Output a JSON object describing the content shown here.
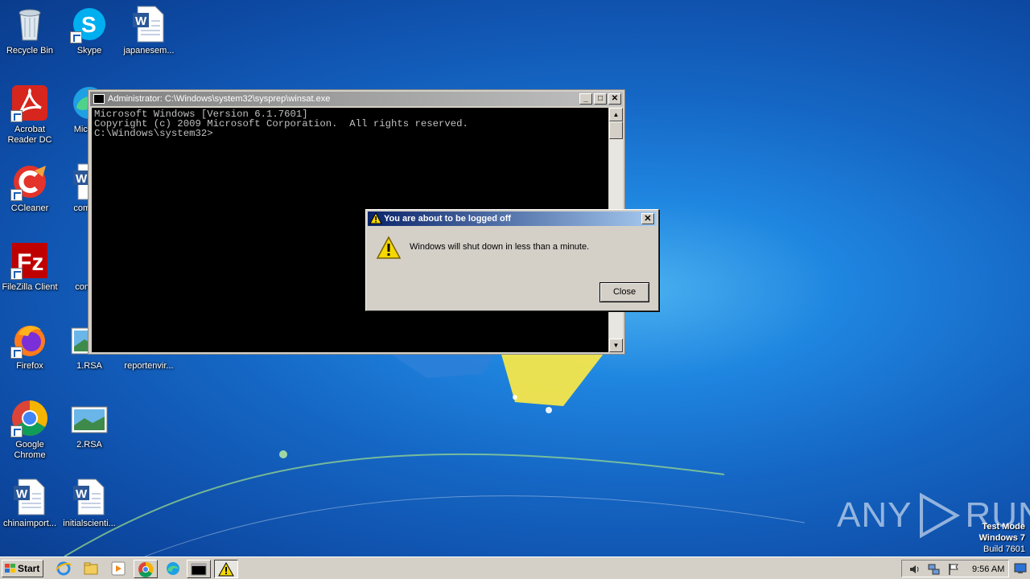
{
  "desktop": {
    "icons": [
      {
        "label": "Recycle Bin",
        "icon": "recycle-bin-icon"
      },
      {
        "label": "Skype",
        "icon": "skype-icon"
      },
      {
        "label": "japanesem...",
        "icon": "word-document-icon"
      },
      {
        "label": "Acrobat Reader DC",
        "icon": "acrobat-icon"
      },
      {
        "label": "Microso",
        "icon": "edge-icon"
      },
      {
        "label": "CCleaner",
        "icon": "ccleaner-icon"
      },
      {
        "label": "comega",
        "icon": "word-document-icon"
      },
      {
        "label": "FileZilla Client",
        "icon": "filezilla-icon"
      },
      {
        "label": "coming",
        "icon": "file-icon"
      },
      {
        "label": "Firefox",
        "icon": "firefox-icon"
      },
      {
        "label": "1.RSA",
        "icon": "image-file-icon"
      },
      {
        "label": "reportenvir...",
        "icon": "file-icon"
      },
      {
        "label": "Google Chrome",
        "icon": "chrome-icon"
      },
      {
        "label": "2.RSA",
        "icon": "image-file-icon"
      },
      {
        "label": "chinaimport...",
        "icon": "word-document-icon"
      },
      {
        "label": "initialscienti...",
        "icon": "word-document-icon"
      }
    ]
  },
  "cmd_window": {
    "title": "Administrator: C:\\Windows\\system32\\sysprep\\winsat.exe",
    "lines": [
      "Microsoft Windows [Version 6.1.7601]",
      "Copyright (c) 2009 Microsoft Corporation.  All rights reserved.",
      "",
      "C:\\Windows\\system32>"
    ],
    "minimize_glyph": "_",
    "maximize_glyph": "□",
    "close_glyph": "✕"
  },
  "dialog": {
    "title": "You are about to be logged off",
    "message": "Windows will shut down in less than a minute.",
    "close_button": "Close",
    "close_glyph": "✕"
  },
  "watermark": {
    "brand_left": "ANY",
    "brand_right": "RUN",
    "test_mode": "Test Mode",
    "os": "Windows 7",
    "build": "Build 7601"
  },
  "taskbar": {
    "start_label": "Start",
    "clock": "9:56 AM",
    "pinned": [
      "ie-icon",
      "explorer-icon",
      "media-player-icon",
      "chrome-icon",
      "edge-icon"
    ],
    "running": [
      "cmd-icon",
      "warning-icon"
    ],
    "tray": [
      "volume-icon",
      "network-icon",
      "action-center-flag-icon"
    ]
  },
  "colors": {
    "desktop_blue": "#1566c4",
    "dialog_title_start": "#0a246a",
    "dialog_title_end": "#a6caf0",
    "warning_yellow": "#f5d800"
  }
}
